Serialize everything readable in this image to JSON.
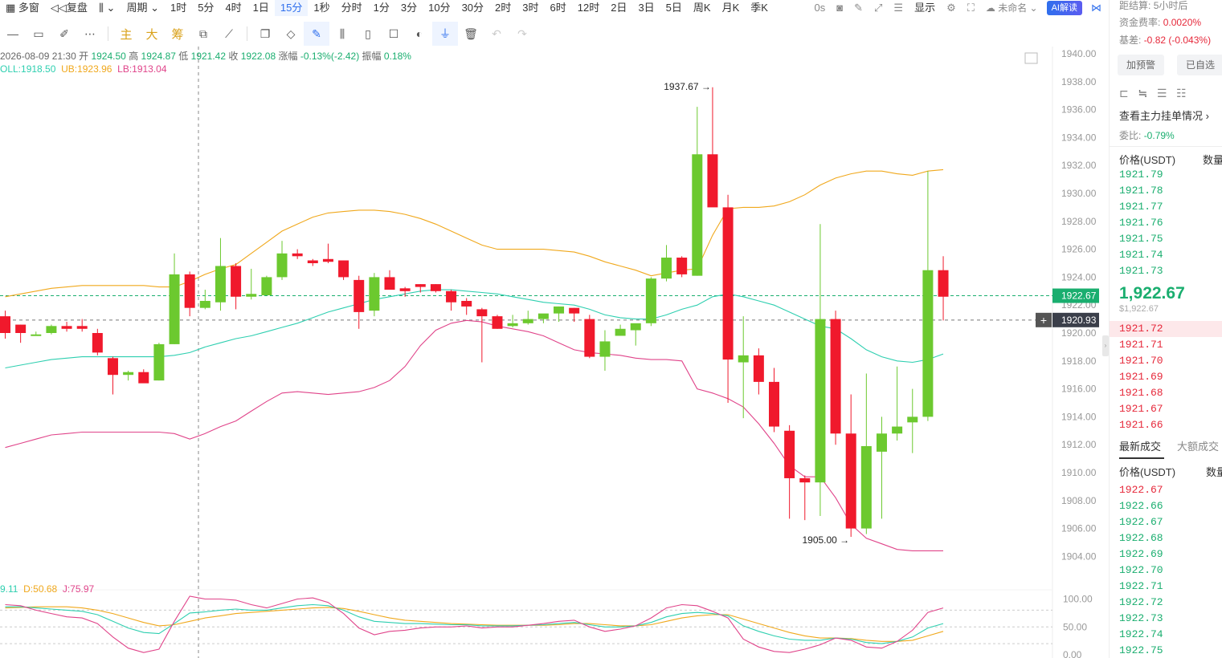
{
  "topbar": {
    "items": [
      "多窗",
      "复盘",
      "",
      "周期",
      "1时",
      "5分",
      "4时",
      "1日",
      "15分",
      "1秒",
      "分时",
      "1分",
      "3分",
      "10分",
      "30分",
      "2时",
      "3时",
      "6时",
      "12时",
      "2日",
      "3日",
      "5日",
      "周K",
      "月K",
      "季K"
    ],
    "active_index": 8,
    "countdown": "0s",
    "display": "显示",
    "layout_name": "未命名",
    "ai_label": "AI解读"
  },
  "toolbar": {
    "ind1": "主",
    "ind2": "大",
    "ind3": "筹"
  },
  "info": {
    "datetime": "2026-08-09 21:30",
    "open_label": "开",
    "open": "1924.50",
    "high_label": "高",
    "high": "1924.87",
    "low_label": "低",
    "low": "1921.42",
    "close_label": "收",
    "close": "1922.08",
    "chg_label": "涨幅",
    "chg": "-0.13%(-2.42)",
    "amp_label": "振幅",
    "amp": "0.18%"
  },
  "boll": {
    "mid_label": "OLL:1918.50",
    "ub_label": "UB:1923.96",
    "lb_label": "LB:1913.04"
  },
  "kdj": {
    "k_label": "9.11",
    "d_label": "D:50.68",
    "j_label": "J:75.97"
  },
  "colors": {
    "up": "#6cc92f",
    "down": "#f0192c",
    "mid": "#2ecfb0",
    "upper": "#f0a81c",
    "lower": "#e0448a",
    "accent": "#2f6fed"
  },
  "chart_data": {
    "type": "candlestick",
    "ylim": [
      1903,
      1941
    ],
    "y_ticks": [
      "1940.00",
      "1938.00",
      "1936.00",
      "1934.00",
      "1932.00",
      "1930.00",
      "1928.00",
      "1926.00",
      "1924.00",
      "1922.00",
      "1920.00",
      "1918.00",
      "1916.00",
      "1914.00",
      "1912.00",
      "1910.00",
      "1908.00",
      "1906.00",
      "1904.00"
    ],
    "last_price_tag": "1922.67",
    "crosshair_tag": "1920.93",
    "high_annot": "1937.67",
    "low_annot": "1905.00",
    "kdj_ticks": [
      "100.00",
      "50.00",
      "0.00"
    ],
    "candles": [
      {
        "o": 1921.2,
        "h": 1921.6,
        "l": 1919.6,
        "c": 1920.0
      },
      {
        "o": 1920.6,
        "h": 1920.6,
        "l": 1919.3,
        "c": 1920.0
      },
      {
        "o": 1919.8,
        "h": 1920.1,
        "l": 1919.8,
        "c": 1919.9
      },
      {
        "o": 1920.0,
        "h": 1920.6,
        "l": 1919.9,
        "c": 1920.5
      },
      {
        "o": 1920.5,
        "h": 1920.8,
        "l": 1920.1,
        "c": 1920.3
      },
      {
        "o": 1920.5,
        "h": 1921.0,
        "l": 1920.1,
        "c": 1920.3
      },
      {
        "o": 1920.0,
        "h": 1920.3,
        "l": 1918.4,
        "c": 1918.6
      },
      {
        "o": 1918.2,
        "h": 1918.3,
        "l": 1915.6,
        "c": 1917.0
      },
      {
        "o": 1917.0,
        "h": 1917.3,
        "l": 1916.6,
        "c": 1917.2
      },
      {
        "o": 1917.2,
        "h": 1917.4,
        "l": 1916.5,
        "c": 1916.4
      },
      {
        "o": 1916.6,
        "h": 1919.3,
        "l": 1916.6,
        "c": 1919.2
      },
      {
        "o": 1919.2,
        "h": 1925.7,
        "l": 1919.2,
        "c": 1924.2
      },
      {
        "o": 1924.2,
        "h": 1924.4,
        "l": 1921.2,
        "c": 1921.8
      },
      {
        "o": 1921.8,
        "h": 1923.1,
        "l": 1921.7,
        "c": 1922.3
      },
      {
        "o": 1922.2,
        "h": 1926.8,
        "l": 1921.6,
        "c": 1924.8
      },
      {
        "o": 1924.8,
        "h": 1925.0,
        "l": 1921.7,
        "c": 1922.6
      },
      {
        "o": 1922.6,
        "h": 1924.6,
        "l": 1922.4,
        "c": 1922.8
      },
      {
        "o": 1922.7,
        "h": 1924.1,
        "l": 1922.7,
        "c": 1924.0
      },
      {
        "o": 1924.0,
        "h": 1926.6,
        "l": 1923.8,
        "c": 1925.7
      },
      {
        "o": 1925.7,
        "h": 1926.0,
        "l": 1925.3,
        "c": 1925.5
      },
      {
        "o": 1925.2,
        "h": 1925.3,
        "l": 1924.8,
        "c": 1925.0
      },
      {
        "o": 1925.3,
        "h": 1926.4,
        "l": 1925.0,
        "c": 1925.1
      },
      {
        "o": 1925.2,
        "h": 1925.2,
        "l": 1923.8,
        "c": 1924.0
      },
      {
        "o": 1923.8,
        "h": 1924.1,
        "l": 1920.3,
        "c": 1921.5
      },
      {
        "o": 1921.6,
        "h": 1924.3,
        "l": 1921.2,
        "c": 1924.0
      },
      {
        "o": 1924.0,
        "h": 1924.5,
        "l": 1923.1,
        "c": 1923.1
      },
      {
        "o": 1923.2,
        "h": 1923.3,
        "l": 1922.6,
        "c": 1923.0
      },
      {
        "o": 1923.5,
        "h": 1923.5,
        "l": 1922.9,
        "c": 1923.3
      },
      {
        "o": 1923.5,
        "h": 1923.5,
        "l": 1922.9,
        "c": 1923.0
      },
      {
        "o": 1923.0,
        "h": 1923.1,
        "l": 1921.6,
        "c": 1922.2
      },
      {
        "o": 1922.3,
        "h": 1922.5,
        "l": 1921.3,
        "c": 1921.9
      },
      {
        "o": 1921.7,
        "h": 1921.8,
        "l": 1917.9,
        "c": 1921.2
      },
      {
        "o": 1921.2,
        "h": 1921.3,
        "l": 1920.3,
        "c": 1920.3
      },
      {
        "o": 1920.5,
        "h": 1921.3,
        "l": 1920.4,
        "c": 1920.7
      },
      {
        "o": 1920.7,
        "h": 1921.6,
        "l": 1920.6,
        "c": 1921.0
      },
      {
        "o": 1921.0,
        "h": 1921.3,
        "l": 1920.7,
        "c": 1921.4
      },
      {
        "o": 1921.4,
        "h": 1921.9,
        "l": 1920.8,
        "c": 1921.9
      },
      {
        "o": 1921.8,
        "h": 1921.8,
        "l": 1920.8,
        "c": 1921.4
      },
      {
        "o": 1921.0,
        "h": 1921.3,
        "l": 1918.2,
        "c": 1918.3
      },
      {
        "o": 1918.3,
        "h": 1920.2,
        "l": 1917.3,
        "c": 1919.4
      },
      {
        "o": 1919.8,
        "h": 1920.6,
        "l": 1919.8,
        "c": 1920.3
      },
      {
        "o": 1920.2,
        "h": 1920.3,
        "l": 1919.1,
        "c": 1920.7
      },
      {
        "o": 1920.7,
        "h": 1924.0,
        "l": 1920.5,
        "c": 1923.9
      },
      {
        "o": 1923.9,
        "h": 1926.3,
        "l": 1923.7,
        "c": 1925.4
      },
      {
        "o": 1925.4,
        "h": 1925.5,
        "l": 1924.0,
        "c": 1924.2
      },
      {
        "o": 1924.1,
        "h": 1936.2,
        "l": 1924.1,
        "c": 1932.8
      },
      {
        "o": 1932.8,
        "h": 1937.6,
        "l": 1929.3,
        "c": 1929.0
      },
      {
        "o": 1929.0,
        "h": 1929.9,
        "l": 1915.0,
        "c": 1918.1
      },
      {
        "o": 1917.9,
        "h": 1921.2,
        "l": 1913.9,
        "c": 1918.4
      },
      {
        "o": 1918.4,
        "h": 1918.9,
        "l": 1915.6,
        "c": 1916.5
      },
      {
        "o": 1916.5,
        "h": 1917.5,
        "l": 1912.9,
        "c": 1913.3
      },
      {
        "o": 1913.0,
        "h": 1913.4,
        "l": 1906.7,
        "c": 1909.6
      },
      {
        "o": 1909.6,
        "h": 1909.8,
        "l": 1906.6,
        "c": 1909.3
      },
      {
        "o": 1909.3,
        "h": 1927.8,
        "l": 1906.9,
        "c": 1921.0
      },
      {
        "o": 1921.0,
        "h": 1921.6,
        "l": 1912.0,
        "c": 1912.8
      },
      {
        "o": 1912.8,
        "h": 1915.6,
        "l": 1905.4,
        "c": 1906.0
      },
      {
        "o": 1906.0,
        "h": 1917.1,
        "l": 1905.6,
        "c": 1911.9
      },
      {
        "o": 1911.5,
        "h": 1914.0,
        "l": 1906.7,
        "c": 1912.8
      },
      {
        "o": 1912.8,
        "h": 1917.6,
        "l": 1912.3,
        "c": 1913.3
      },
      {
        "o": 1913.6,
        "h": 1916.0,
        "l": 1911.4,
        "c": 1914.0
      },
      {
        "o": 1914.0,
        "h": 1931.6,
        "l": 1913.7,
        "c": 1924.5
      },
      {
        "o": 1924.5,
        "h": 1925.5,
        "l": 1920.9,
        "c": 1922.6
      }
    ],
    "boll_mid": [
      1917.5,
      1917.7,
      1917.9,
      1918.1,
      1918.2,
      1918.3,
      1918.3,
      1918.3,
      1918.3,
      1918.3,
      1918.3,
      1918.4,
      1918.6,
      1919.0,
      1919.3,
      1919.6,
      1919.8,
      1920.1,
      1920.4,
      1920.7,
      1921.1,
      1921.5,
      1921.8,
      1922.1,
      1922.4,
      1922.6,
      1922.8,
      1923.0,
      1923.1,
      1923.1,
      1923.0,
      1922.9,
      1922.8,
      1922.6,
      1922.4,
      1922.2,
      1922.1,
      1922.0,
      1921.7,
      1921.3,
      1921.1,
      1921.0,
      1921.0,
      1921.3,
      1921.7,
      1922.0,
      1922.6,
      1922.8,
      1922.6,
      1922.3,
      1922.0,
      1921.5,
      1921.0,
      1920.5,
      1920.3,
      1919.6,
      1918.8,
      1918.3,
      1918.0,
      1917.9,
      1918.1,
      1918.5
    ],
    "boll_upper": [
      1922.6,
      1922.8,
      1923.0,
      1923.2,
      1923.3,
      1923.4,
      1923.4,
      1923.4,
      1923.4,
      1923.4,
      1923.3,
      1923.3,
      1923.7,
      1924.2,
      1924.6,
      1924.9,
      1925.7,
      1926.5,
      1927.3,
      1927.8,
      1928.3,
      1928.6,
      1928.7,
      1928.8,
      1928.8,
      1928.7,
      1928.5,
      1928.2,
      1927.8,
      1927.3,
      1926.8,
      1926.3,
      1926.0,
      1926.0,
      1926.0,
      1926.0,
      1925.9,
      1925.8,
      1925.5,
      1925.1,
      1924.8,
      1924.5,
      1924.1,
      1924.3,
      1924.5,
      1924.6,
      1927.0,
      1928.9,
      1929.0,
      1929.0,
      1929.1,
      1929.4,
      1929.9,
      1930.6,
      1931.1,
      1931.4,
      1931.6,
      1931.6,
      1931.4,
      1931.3,
      1931.6,
      1931.7
    ],
    "boll_lower": [
      1911.8,
      1912.1,
      1912.4,
      1912.7,
      1912.8,
      1912.9,
      1912.9,
      1912.9,
      1912.9,
      1912.9,
      1912.9,
      1912.8,
      1912.4,
      1912.8,
      1913.3,
      1913.7,
      1914.4,
      1915.1,
      1915.7,
      1915.8,
      1915.7,
      1915.6,
      1915.7,
      1915.8,
      1916.1,
      1916.6,
      1917.6,
      1919.1,
      1920.2,
      1920.7,
      1920.9,
      1920.8,
      1920.5,
      1920.3,
      1920.1,
      1919.8,
      1919.3,
      1918.8,
      1918.6,
      1918.5,
      1918.4,
      1918.2,
      1918.1,
      1918.1,
      1918.0,
      1916.0,
      1915.7,
      1915.3,
      1914.7,
      1913.5,
      1912.1,
      1910.5,
      1909.7,
      1909.7,
      1908.2,
      1906.3,
      1905.3,
      1904.9,
      1904.5,
      1904.4,
      1904.4,
      1904.4
    ],
    "kdj_k": [
      86,
      86,
      84,
      82,
      80,
      78,
      72,
      60,
      48,
      40,
      38,
      56,
      75,
      77,
      80,
      82,
      80,
      80,
      84,
      88,
      90,
      88,
      80,
      68,
      60,
      58,
      56,
      56,
      55,
      54,
      54,
      52,
      52,
      52,
      53,
      54,
      56,
      58,
      54,
      50,
      50,
      52,
      58,
      68,
      74,
      76,
      74,
      70,
      52,
      42,
      34,
      28,
      26,
      26,
      30,
      28,
      22,
      20,
      24,
      32,
      48,
      56
    ],
    "kdj_d": [
      84,
      85,
      86,
      86,
      86,
      84,
      80,
      74,
      66,
      58,
      52,
      54,
      60,
      66,
      70,
      74,
      76,
      78,
      80,
      82,
      84,
      85,
      83,
      78,
      72,
      66,
      62,
      60,
      58,
      56,
      55,
      54,
      53,
      53,
      53,
      53,
      54,
      56,
      56,
      54,
      52,
      52,
      54,
      60,
      66,
      70,
      72,
      72,
      64,
      56,
      48,
      40,
      34,
      30,
      30,
      29,
      26,
      24,
      24,
      26,
      34,
      42
    ],
    "kdj_j": [
      90,
      88,
      80,
      74,
      68,
      66,
      56,
      32,
      12,
      4,
      10,
      60,
      105,
      100,
      100,
      98,
      90,
      84,
      92,
      100,
      102,
      94,
      74,
      48,
      36,
      42,
      44,
      48,
      50,
      50,
      52,
      48,
      50,
      50,
      53,
      56,
      60,
      62,
      50,
      42,
      46,
      52,
      66,
      84,
      90,
      88,
      78,
      66,
      28,
      14,
      6,
      4,
      10,
      18,
      30,
      26,
      14,
      12,
      24,
      44,
      76,
      84
    ]
  },
  "right": {
    "settle_label": "距结算:",
    "settle_value": "5小时后",
    "funding_label": "资金费率:",
    "funding_value": "0.0020%",
    "basis_label": "基差:",
    "basis_value": "-0.82 (-0.043%)",
    "btn_alert": "加预警",
    "btn_fav": "已自选",
    "orders_link": "查看主力挂单情况",
    "ratio_label": "委比:",
    "ratio_value": "-0.79%",
    "price_header": "价格(USDT)",
    "qty_header": "数量",
    "asks": [
      "1921.79",
      "1921.78",
      "1921.77",
      "1921.76",
      "1921.75",
      "1921.74",
      "1921.73"
    ],
    "last_price": "1,922.67",
    "last_price_usd": "$1,922.67",
    "bids": [
      "1921.72",
      "1921.71",
      "1921.70",
      "1921.69",
      "1921.68",
      "1921.67",
      "1921.66"
    ],
    "tab_latest": "最新成交",
    "tab_large": "大额成交",
    "trade_price_header": "价格(USDT)",
    "trade_qty_header": "数量",
    "trades": [
      "1922.67",
      "1922.66",
      "1922.67",
      "1922.68",
      "1922.69",
      "1922.70",
      "1922.71",
      "1922.72",
      "1922.73",
      "1922.74",
      "1922.75"
    ]
  }
}
